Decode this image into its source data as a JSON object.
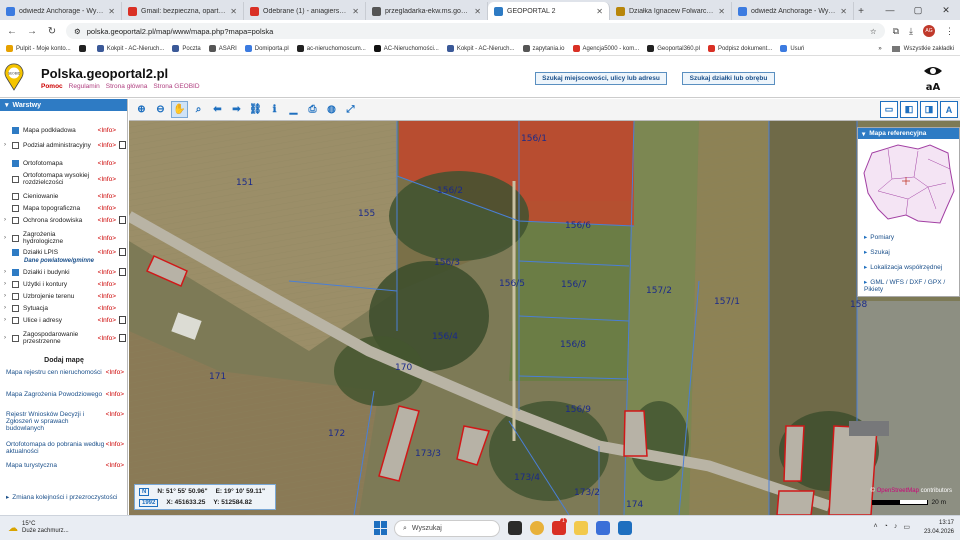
{
  "browser": {
    "tabs": [
      {
        "label": "odwiedź Anchorage - Wyszukaj",
        "color": "#3c7be0",
        "active": false
      },
      {
        "label": "Gmail: bezpieczna, oparta na AI",
        "color": "#d93025",
        "active": false
      },
      {
        "label": "Odebrane (1) - aniagierszewsk",
        "color": "#d93025",
        "active": false
      },
      {
        "label": "przegladarka-ekw.ms.gov.pl/eu",
        "color": "#555555",
        "active": false
      },
      {
        "label": "GEOPORTAL 2",
        "color": "#2e7bc4",
        "active": true
      },
      {
        "label": "Działka Ignacew Folwarczny, bo",
        "color": "#b8860b",
        "active": false
      },
      {
        "label": "odwiedź Anchorage - Wyszukaj",
        "color": "#3c7be0",
        "active": false
      }
    ],
    "url": "polska.geoportal2.pl/map/www/mapa.php?mapa=polska",
    "profile_initials": "AG",
    "bookmarks": [
      {
        "label": "Pulpit - Moje konto...",
        "color": "#e6a100"
      },
      {
        "label": "",
        "color": "#222222"
      },
      {
        "label": "Kokpit - AC-Nieruch...",
        "color": "#3b5998"
      },
      {
        "label": "Poczta",
        "color": "#3b5998"
      },
      {
        "label": "ASARI",
        "color": "#555555"
      },
      {
        "label": "Domiporta.pl",
        "color": "#3c7be0"
      },
      {
        "label": "ac-nieruchomoscum...",
        "color": "#222222"
      },
      {
        "label": "AC-Nieruchomości...",
        "color": "#111111"
      },
      {
        "label": "Kokpit - AC-Nieruch...",
        "color": "#3b5998"
      },
      {
        "label": "zapytania.io",
        "color": "#555555"
      },
      {
        "label": "Agencja5000 - kom...",
        "color": "#d93025"
      },
      {
        "label": "Geoportal360.pl",
        "color": "#222222"
      },
      {
        "label": "Podpisz dokument...",
        "color": "#d93025"
      },
      {
        "label": "Usuń",
        "color": "#3c7be0"
      }
    ],
    "all_bookmarks": "Wszystkie zakładki"
  },
  "header": {
    "title": "Polska.geoportal2.pl",
    "help": "Pomoc",
    "links": [
      "Regulamin",
      "Strona główna",
      "Strona GEOBID"
    ],
    "logo_text": "GEOBID",
    "search_location_button": "Szukaj miejscowości, ulicy lub adresu",
    "search_parcel_button": "Szukaj działki lub obrębu"
  },
  "layers_panel": {
    "title": "Warstwy",
    "info_label": "<Info>",
    "layers": [
      {
        "name": "Mapa podkładowa",
        "checked": true,
        "expand": false,
        "doc": false
      },
      {
        "name": "Podział administracyjny",
        "checked": false,
        "expand": true,
        "doc": true
      },
      {
        "name": "Ortofotomapa",
        "checked": true,
        "expand": false,
        "doc": false
      },
      {
        "name": "Ortofotomapa wysokiej rozdzielczości",
        "checked": false,
        "expand": false,
        "doc": false
      },
      {
        "name": "Cieniowanie",
        "checked": false,
        "expand": false,
        "doc": false
      },
      {
        "name": "Mapa topograficzna",
        "checked": false,
        "expand": false,
        "doc": false
      },
      {
        "name": "Ochrona środowiska",
        "checked": false,
        "expand": true,
        "doc": true
      },
      {
        "name": "Zagrożenia hydrologiczne",
        "checked": false,
        "expand": true,
        "doc": false
      },
      {
        "name": "Działki LPIS",
        "checked": true,
        "expand": false,
        "doc": true
      },
      {
        "name": "Działki i budynki",
        "checked": true,
        "expand": true,
        "doc": true
      },
      {
        "name": "Użytki i kontury",
        "checked": false,
        "expand": true,
        "doc": false
      },
      {
        "name": "Uzbrojenie terenu",
        "checked": false,
        "expand": true,
        "doc": false
      },
      {
        "name": "Sytuacja",
        "checked": false,
        "expand": true,
        "doc": false
      },
      {
        "name": "Ulice i adresy",
        "checked": false,
        "expand": true,
        "doc": true
      },
      {
        "name": "Zagospodarowanie przestrzenne",
        "checked": false,
        "expand": true,
        "doc": true
      }
    ],
    "sublabel": "Dane powiatowe/gminne",
    "add_map_title": "Dodaj mapę",
    "maps": [
      "Mapa rejestru cen nieruchomości",
      "Mapa Zagrożenia Powodziowego",
      "Rejestr Wniosków Decyzji i Zgłoszeń w sprawach budowlanych",
      "Ortofotomapa do pobrania według aktualności",
      "Mapa turystyczna"
    ],
    "order_link": "Zmiana kolejności i przezroczystości"
  },
  "reference_panel": {
    "title": "Mapa referencyjna",
    "links": [
      "Pomiary",
      "Szukaj",
      "Lokalizacja współrzędnej",
      "GML / WFS / DXF / GPX / Pikiety"
    ]
  },
  "map": {
    "parcels": [
      "156/1",
      "151",
      "156/2",
      "155",
      "156/6",
      "156/3",
      "156/5",
      "156/7",
      "157/2",
      "157/1",
      "158",
      "156/4",
      "156/8",
      "171",
      "170",
      "156/9",
      "172",
      "173/3",
      "173/4",
      "173/2",
      "174"
    ],
    "coords": {
      "badge1": "N",
      "lat": "N: 51° 55' 50.96\"",
      "lon": "E: 19° 10' 59.11\"",
      "badge2": "1992",
      "x": "X: 451633.25",
      "y": "Y: 512584.82"
    },
    "attribution_prefix": "©",
    "attribution_osm": "OpenStreetMap",
    "attribution_suffix": "contributors",
    "scale_label": "20 m"
  },
  "taskbar": {
    "temperature": "15°C",
    "weather": "Duże zachmurz...",
    "search_placeholder": "Wyszukaj",
    "time": "13:17",
    "date": "23.04.2026",
    "notification_count": "1"
  }
}
